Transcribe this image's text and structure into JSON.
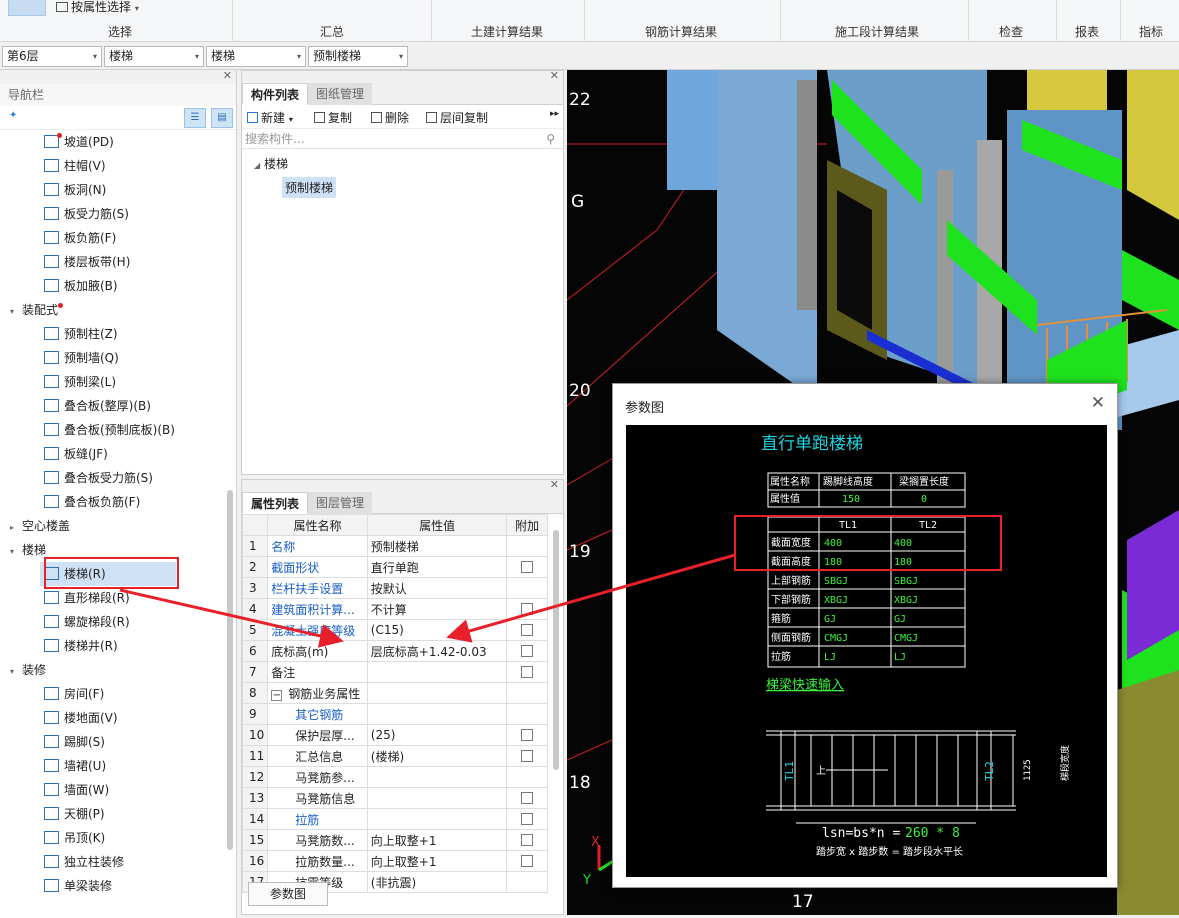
{
  "ribbon": {
    "prop_select": "按属性选择",
    "groups": [
      "选择",
      "汇总",
      "土建计算结果",
      "钢筋计算结果",
      "施工段计算结果",
      "检查",
      "报表",
      "指标"
    ]
  },
  "floorbar": {
    "floor": "第6层",
    "category": "楼梯",
    "type": "楼梯",
    "component": "预制楼梯"
  },
  "nav": {
    "title": "导航栏",
    "items": [
      {
        "label": "坡道(PD)",
        "dot": true
      },
      {
        "label": "柱帽(V)"
      },
      {
        "label": "板洞(N)"
      },
      {
        "label": "板受力筋(S)"
      },
      {
        "label": "板负筋(F)"
      },
      {
        "label": "楼层板带(H)"
      },
      {
        "label": "板加腋(B)"
      }
    ],
    "cat_prefab": "装配式",
    "prefab_items": [
      {
        "label": "预制柱(Z)"
      },
      {
        "label": "预制墙(Q)"
      },
      {
        "label": "预制梁(L)"
      },
      {
        "label": "叠合板(整厚)(B)"
      },
      {
        "label": "叠合板(预制底板)(B)"
      },
      {
        "label": "板缝(JF)"
      },
      {
        "label": "叠合板受力筋(S)"
      },
      {
        "label": "叠合板负筋(F)"
      }
    ],
    "cat_hollow": "空心楼盖",
    "cat_stair": "楼梯",
    "stair_items": [
      {
        "label": "楼梯(R)"
      },
      {
        "label": "直形梯段(R)"
      },
      {
        "label": "螺旋梯段(R)"
      },
      {
        "label": "楼梯井(R)"
      }
    ],
    "cat_deco": "装修",
    "deco_items": [
      {
        "label": "房间(F)"
      },
      {
        "label": "楼地面(V)"
      },
      {
        "label": "踢脚(S)"
      },
      {
        "label": "墙裙(U)"
      },
      {
        "label": "墙面(W)"
      },
      {
        "label": "天棚(P)"
      },
      {
        "label": "吊顶(K)"
      },
      {
        "label": "独立柱装修"
      },
      {
        "label": "单梁装修"
      }
    ]
  },
  "components": {
    "tab_active": "构件列表",
    "tab_other": "图纸管理",
    "new_label": "新建",
    "copy_label": "复制",
    "delete_label": "删除",
    "floor_copy_label": "层间复制",
    "search_placeholder": "搜索构件...",
    "tree_root": "楼梯",
    "tree_child": "预制楼梯"
  },
  "properties": {
    "tab_active": "属性列表",
    "tab_other": "图层管理",
    "col_name": "属性名称",
    "col_value": "属性值",
    "col_extra": "附加",
    "rows": [
      {
        "n": "1",
        "name": "名称",
        "value": "预制楼梯",
        "blue": true,
        "cb": false
      },
      {
        "n": "2",
        "name": "截面形状",
        "value": "直行单跑",
        "blue": true,
        "cb": true
      },
      {
        "n": "3",
        "name": "栏杆扶手设置",
        "value": "按默认",
        "blue": true,
        "cb": false
      },
      {
        "n": "4",
        "name": "建筑面积计算...",
        "value": "不计算",
        "blue": true,
        "cb": true
      },
      {
        "n": "5",
        "name": "混凝土强度等级",
        "value": "(C15)",
        "blue": true,
        "cb": true
      },
      {
        "n": "6",
        "name": "底标高(m)",
        "value": "层底标高+1.42-0.03",
        "blue": false,
        "cb": true
      },
      {
        "n": "7",
        "name": "备注",
        "value": "",
        "blue": false,
        "cb": true
      },
      {
        "n": "8",
        "name": "钢筋业务属性",
        "value": "",
        "blue": false,
        "cb": false,
        "group": true
      },
      {
        "n": "9",
        "name": "其它钢筋",
        "value": "",
        "blue": true,
        "cb": false,
        "indent": true
      },
      {
        "n": "10",
        "name": "保护层厚...",
        "value": "(25)",
        "blue": false,
        "cb": true,
        "indent": true
      },
      {
        "n": "11",
        "name": "汇总信息",
        "value": "(楼梯)",
        "blue": false,
        "cb": true,
        "indent": true
      },
      {
        "n": "12",
        "name": "马凳筋参...",
        "value": "",
        "blue": false,
        "cb": false,
        "indent": true
      },
      {
        "n": "13",
        "name": "马凳筋信息",
        "value": "",
        "blue": false,
        "cb": true,
        "indent": true
      },
      {
        "n": "14",
        "name": "拉筋",
        "value": "",
        "blue": true,
        "cb": true,
        "indent": true
      },
      {
        "n": "15",
        "name": "马凳筋数...",
        "value": "向上取整+1",
        "blue": false,
        "cb": true,
        "indent": true
      },
      {
        "n": "16",
        "name": "拉筋数量...",
        "value": "向上取整+1",
        "blue": false,
        "cb": true,
        "indent": true
      },
      {
        "n": "17",
        "name": "抗震等级",
        "value": "(非抗震)",
        "blue": false,
        "cb": false,
        "indent": true
      }
    ],
    "param_button": "参数图"
  },
  "viewport": {
    "axis_labels": [
      "22",
      "G",
      "20",
      "19",
      "18",
      "17"
    ],
    "axis_x": "X",
    "axis_y": "Y"
  },
  "dialog": {
    "title": "参数图",
    "drawing_title": "直行单跑楼梯",
    "t1_headers": [
      "属性名称",
      "踢脚线高度",
      "梁搁置长度"
    ],
    "t1_row": [
      "属性值",
      "150",
      "0"
    ],
    "t2_headers": [
      "",
      "TL1",
      "TL2"
    ],
    "t2_rows": [
      [
        "截面宽度",
        "400",
        "400"
      ],
      [
        "截面高度",
        "180",
        "180"
      ],
      [
        "上部钢筋",
        "SBGJ",
        "SBGJ"
      ],
      [
        "下部钢筋",
        "XBGJ",
        "XBGJ"
      ],
      [
        "箍筋",
        "GJ",
        "GJ"
      ],
      [
        "侧面钢筋",
        "CMGJ",
        "CMGJ"
      ],
      [
        "拉筋",
        "LJ",
        "LJ"
      ]
    ],
    "quick_link": "梯梁快速输入",
    "tl1": "TL1",
    "tl2": "TL2",
    "up": "上",
    "dim_right": "1125",
    "dim_right_label": "梯段宽度",
    "formula_prefix": "lsn=bs*n = ",
    "formula_value": "260 * 8",
    "formula_caption": "踏步宽 x 踏步数 = 踏步段水平长"
  },
  "colors": {
    "annotation": "#e8202a",
    "cad_cyan": "#1fd4e0",
    "cad_green": "#3cf23c",
    "selection": "#cfe1f5"
  }
}
